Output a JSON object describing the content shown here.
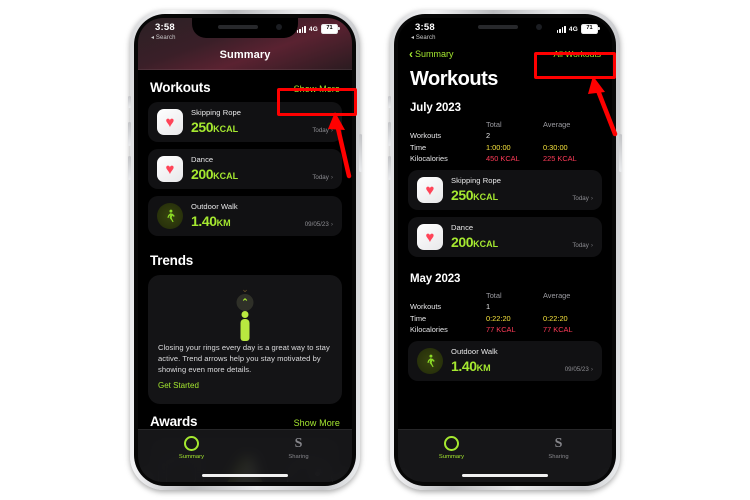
{
  "status_bar": {
    "time": "3:58",
    "back_label": "Search",
    "network": "4G",
    "battery": "71"
  },
  "left_phone": {
    "nav_title": "Summary",
    "sections": [
      {
        "title": "Workouts",
        "link": "Show More"
      },
      {
        "title": "Trends",
        "body": "Closing your rings every day is a great way to stay active. Trend arrows help you stay motivated by showing even more details.",
        "cta": "Get Started"
      },
      {
        "title": "Awards",
        "link": "Show More"
      }
    ],
    "workouts": [
      {
        "name": "Skipping Rope",
        "value": "250",
        "unit": "KCAL",
        "date": "Today",
        "icon": "heart-icon"
      },
      {
        "name": "Dance",
        "value": "200",
        "unit": "KCAL",
        "date": "Today",
        "icon": "heart-icon"
      },
      {
        "name": "Outdoor Walk",
        "value": "1.40",
        "unit": "KM",
        "date": "09/05/23",
        "icon": "walking-icon"
      }
    ],
    "tabs": [
      {
        "label": "Summary",
        "icon": "activity-ring-icon",
        "active": true
      },
      {
        "label": "Sharing",
        "icon": "sharing-icon",
        "active": false
      }
    ]
  },
  "right_phone": {
    "back_label": "Summary",
    "right_link": "All Workouts",
    "title": "Workouts",
    "groups": [
      {
        "month": "July 2023",
        "columns": [
          "Total",
          "Average"
        ],
        "rows": [
          {
            "label": "Workouts",
            "total": "2",
            "average": "",
            "style": "white"
          },
          {
            "label": "Time",
            "total": "1:00:00",
            "average": "0:30:00",
            "style": "yellow"
          },
          {
            "label": "Kilocalories",
            "total": "450 KCAL",
            "average": "225 KCAL",
            "style": "red"
          }
        ],
        "workouts": [
          {
            "name": "Skipping Rope",
            "value": "250",
            "unit": "KCAL",
            "date": "Today",
            "icon": "heart-icon"
          },
          {
            "name": "Dance",
            "value": "200",
            "unit": "KCAL",
            "date": "Today",
            "icon": "heart-icon"
          }
        ]
      },
      {
        "month": "May 2023",
        "columns": [
          "Total",
          "Average"
        ],
        "rows": [
          {
            "label": "Workouts",
            "total": "1",
            "average": "",
            "style": "white"
          },
          {
            "label": "Time",
            "total": "0:22:20",
            "average": "0:22:20",
            "style": "yellow"
          },
          {
            "label": "Kilocalories",
            "total": "77 KCAL",
            "average": "77 KCAL",
            "style": "red"
          }
        ],
        "workouts": [
          {
            "name": "Outdoor Walk",
            "value": "1.40",
            "unit": "KM",
            "date": "09/05/23",
            "icon": "walking-icon"
          }
        ]
      }
    ],
    "tabs": [
      {
        "label": "Summary",
        "icon": "activity-ring-icon",
        "active": true
      },
      {
        "label": "Sharing",
        "icon": "sharing-icon",
        "active": false
      }
    ]
  },
  "annotations": {
    "color": "#ff0000",
    "highlight_left": "Show More",
    "highlight_right": "All Workouts"
  }
}
